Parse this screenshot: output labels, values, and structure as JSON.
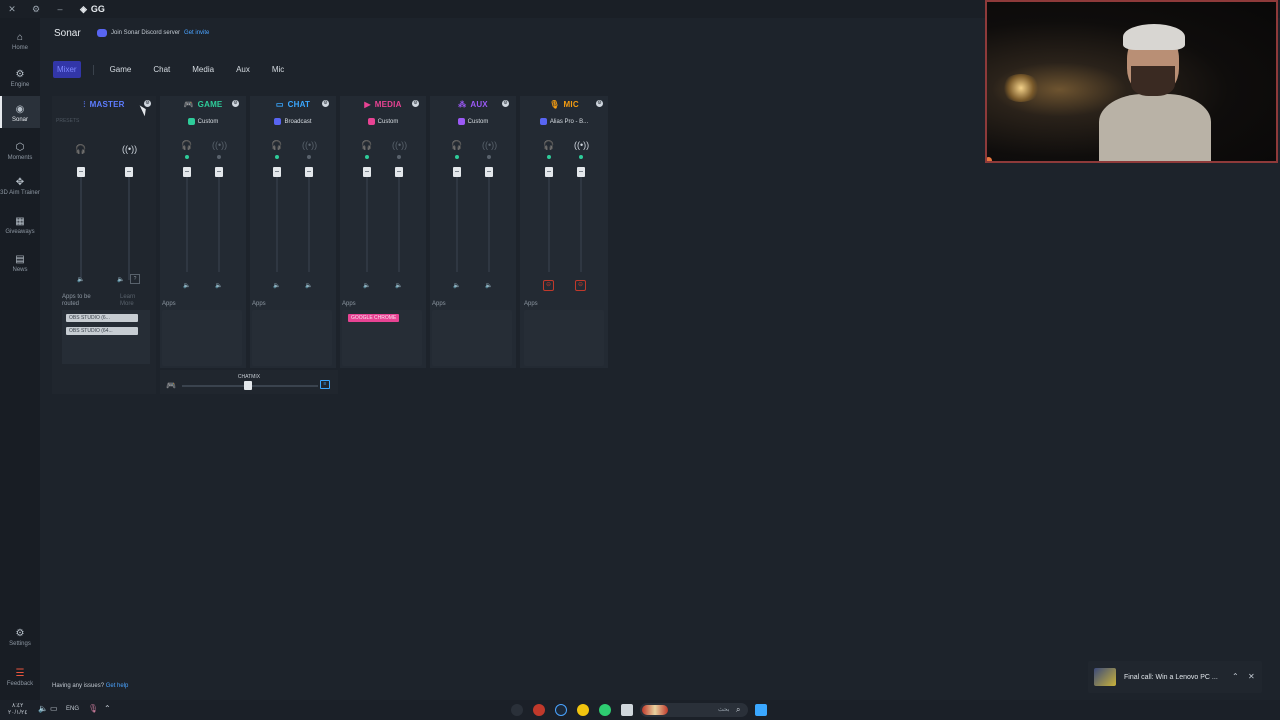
{
  "titlebar": {
    "app_name": "GG",
    "close": "✕",
    "settings": "⚙",
    "minimize": "–",
    "app_icon": "◈"
  },
  "rail": {
    "items": [
      {
        "label": "Home",
        "icon": "⌂"
      },
      {
        "label": "Engine",
        "icon": "⚙"
      },
      {
        "label": "Sonar",
        "icon": "◉"
      },
      {
        "label": "Moments",
        "icon": "⬡"
      },
      {
        "label": "3D Aim Trainer",
        "icon": "✥"
      },
      {
        "label": "Giveaways",
        "icon": "▦"
      },
      {
        "label": "News",
        "icon": "▤"
      }
    ],
    "settings": {
      "label": "Settings",
      "icon": "⚙"
    },
    "feedback": {
      "label": "Feedback",
      "icon": "☰"
    }
  },
  "header": {
    "title": "Sonar",
    "discord_text": "Join Sonar Discord server",
    "discord_link": "Get invite"
  },
  "tabs": [
    "Mixer",
    "Game",
    "Chat",
    "Media",
    "Aux",
    "Mic"
  ],
  "mixer": {
    "master": {
      "title": "MASTER",
      "icon": "⫶",
      "presets_label": "PRESETS",
      "apps_label_1": "Apps to be routed",
      "apps_label_2": "Learn More",
      "badge": "?",
      "apps": [
        "OBS STUDIO (6...",
        "OBS STUDIO (64..."
      ],
      "headphone_level": 1.0,
      "stream_level": 1.0
    },
    "channels": [
      {
        "title": "GAME",
        "icon": "🎮",
        "color": "#2ecc9a",
        "preset": "Custom",
        "preset_color": "#2ecc9a",
        "apps_label": "Apps",
        "apps": [],
        "level_a": 1.0,
        "level_b": 1.0
      },
      {
        "title": "CHAT",
        "icon": "▭",
        "color": "#3aa7ff",
        "preset": "Broadcast",
        "preset_color": "#5865f2",
        "apps_label": "Apps",
        "apps": [],
        "level_a": 1.0,
        "level_b": 1.0
      },
      {
        "title": "MEDIA",
        "icon": "▶",
        "color": "#e84393",
        "preset": "Custom",
        "preset_color": "#e84393",
        "apps_label": "Apps",
        "apps": [
          "GOOGLE CHROME"
        ],
        "level_a": 1.0,
        "level_b": 1.0
      },
      {
        "title": "AUX",
        "icon": "⁂",
        "color": "#9b59f6",
        "preset": "Custom",
        "preset_color": "#9b59f6",
        "apps_label": "Apps",
        "apps": [],
        "level_a": 1.0,
        "level_b": 1.0
      },
      {
        "title": "MIC",
        "icon": "🎙",
        "color": "#f39c12",
        "preset": "Alias Pro - B...",
        "preset_color": "#5865f2",
        "apps_label": "Apps",
        "apps": [],
        "level_a": 1.0,
        "level_b": 1.0
      }
    ],
    "chatmix": {
      "label": "CHATMIX",
      "level": 0.6
    }
  },
  "footer": {
    "issues_text": "Having any issues?",
    "issues_link": "Get help"
  },
  "toast": {
    "text": "Final call: Win a Lenovo PC ...",
    "up": "⌃",
    "close": "✕"
  },
  "taskbar": {
    "time": "٨:٤٢",
    "date": "٢٠/١/٢٤",
    "lang": "ENG",
    "search_text": "بحث",
    "search_icon": "⌕"
  },
  "colors": {
    "accent": "#5865f2",
    "master_title": "#5d7cff",
    "background": "#1d232b"
  }
}
